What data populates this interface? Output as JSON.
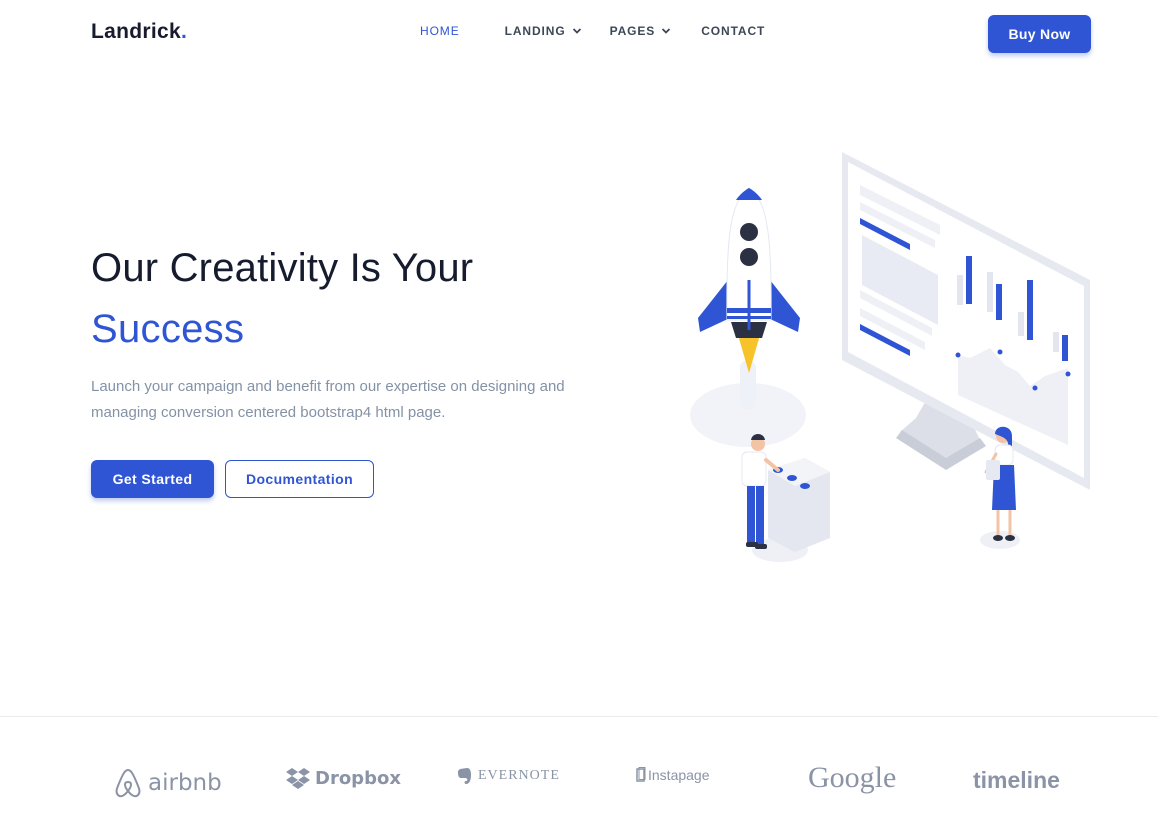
{
  "header": {
    "logo_text": "Landrick",
    "logo_dot": ".",
    "nav": [
      {
        "label": "HOME",
        "active": true,
        "has_dropdown": false
      },
      {
        "label": "LANDING",
        "active": false,
        "has_dropdown": true
      },
      {
        "label": "PAGES",
        "active": false,
        "has_dropdown": true
      },
      {
        "label": "CONTACT",
        "active": false,
        "has_dropdown": false
      }
    ],
    "buy_label": "Buy Now"
  },
  "hero": {
    "title_line1": "Our Creativity Is Your",
    "title_line2": "Success",
    "description": "Launch your campaign and benefit from our expertise on designing and managing conversion centered bootstrap4 html page.",
    "primary_button": "Get Started",
    "secondary_button": "Documentation"
  },
  "partners": [
    {
      "name": "airbnb",
      "icon": "airbnb-icon"
    },
    {
      "name": "Dropbox",
      "icon": "dropbox-icon"
    },
    {
      "name": "EVERNOTE",
      "icon": "evernote-icon"
    },
    {
      "name": "Instapage",
      "icon": "instapage-icon"
    },
    {
      "name": "Google",
      "icon": ""
    },
    {
      "name": "timeline",
      "icon": ""
    }
  ],
  "colors": {
    "primary": "#2f55d4",
    "heading": "#161c2d",
    "muted": "#8492a6",
    "partner_gray": "#8a94a6",
    "rocket_flame": "#f6c32b"
  }
}
